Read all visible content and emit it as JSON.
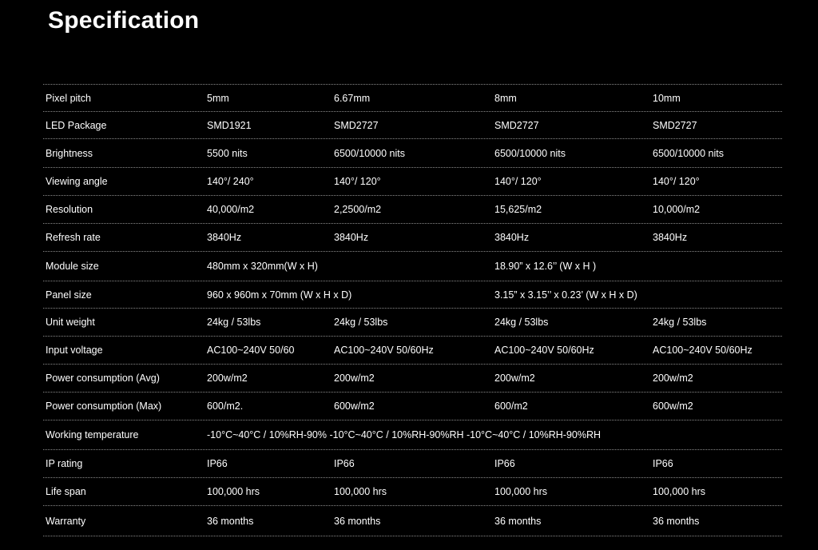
{
  "page": {
    "title": "Specification"
  },
  "rows": [
    {
      "label": "Pixel pitch",
      "values": [
        "5mm",
        "6.67mm",
        "8mm",
        "10mm"
      ]
    },
    {
      "label": "LED Package",
      "values": [
        "SMD1921",
        "SMD2727",
        "SMD2727",
        "SMD2727"
      ]
    },
    {
      "label": "Brightness",
      "values": [
        "5500 nits",
        "6500/10000 nits",
        "6500/10000 nits",
        "6500/10000 nits"
      ]
    },
    {
      "label": "Viewing angle",
      "values": [
        "140°/ 240°",
        "140°/ 120°",
        "140°/ 120°",
        "140°/ 120°"
      ]
    },
    {
      "label": "Resolution",
      "values": [
        "40,000/m2",
        "2,2500/m2",
        "15,625/m2",
        "10,000/m2"
      ]
    },
    {
      "label": "Refresh rate",
      "values": [
        "3840Hz",
        "3840Hz",
        "3840Hz",
        "3840Hz"
      ]
    },
    {
      "label": "Module size",
      "left": "480mm x 320mm(W x H)",
      "right": "18.90” x 12.6’’ (W x H )"
    },
    {
      "label": "Panel size",
      "left": "960 x 960m x 70mm (W x H x D)",
      "right": "3.15” x 3.15’’ x 0.23’  (W x H x D)"
    },
    {
      "label": "Unit weight",
      "values": [
        "24kg / 53lbs",
        "24kg / 53lbs",
        "24kg / 53lbs",
        "24kg / 53lbs"
      ]
    },
    {
      "label": "Input voltage",
      "values": [
        "AC100~240V 50/60",
        "AC100~240V 50/60Hz",
        "AC100~240V 50/60Hz",
        "AC100~240V 50/60Hz"
      ]
    },
    {
      "label": "Power consumption (Avg)",
      "values": [
        "200w/m2",
        "200w/m2",
        "200w/m2",
        "200w/m2"
      ]
    },
    {
      "label": "Power consumption (Max)",
      "values": [
        "600/m2.",
        "600w/m2",
        "600/m2",
        "600w/m2"
      ]
    },
    {
      "label": "Working temperature",
      "left": "-10°C~40°C / 10%RH-90% -10°C~40°C / 10%RH-90%RH -10°C~40°C / 10%RH-90%RH"
    },
    {
      "label": "IP rating",
      "values": [
        "IP66",
        "IP66",
        "IP66",
        "IP66"
      ]
    },
    {
      "label": "Life span",
      "values": [
        "100,000 hrs",
        "100,000 hrs",
        "100,000 hrs",
        "100,000 hrs"
      ]
    },
    {
      "label": "Warranty",
      "values": [
        "36 months",
        "36 months",
        "36 months",
        "36 months"
      ]
    }
  ]
}
